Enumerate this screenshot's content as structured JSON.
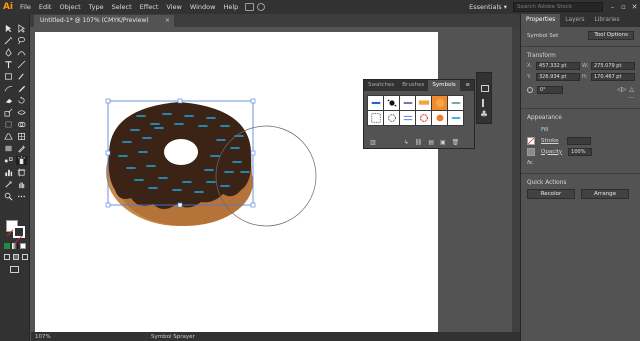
{
  "app": {
    "logo": "Ai"
  },
  "menu": {
    "items": [
      "File",
      "Edit",
      "Object",
      "Type",
      "Select",
      "Effect",
      "View",
      "Window",
      "Help"
    ]
  },
  "workspace": {
    "label": "Essentials ▾",
    "search_placeholder": "Search Adobe Stock"
  },
  "window_buttons": [
    "–",
    "▫",
    "✕"
  ],
  "document": {
    "tab_title": "Untitled-1* @ 107% (CMYK/Preview)",
    "close": "×"
  },
  "status": {
    "zoom": "107%",
    "tool": "Symbol Sprayer"
  },
  "properties": {
    "tabs": [
      "Properties",
      "Layers",
      "Libraries"
    ],
    "selection_type": "Symbol Set",
    "tool_options": "Tool Options",
    "transform_title": "Transform",
    "x_label": "X:",
    "x_value": "457.332 pt",
    "y_label": "Y:",
    "y_value": "326.934 pt",
    "w_label": "W:",
    "w_value": "275.079 pt",
    "h_label": "H:",
    "h_value": "170.467 pt",
    "rotate_value": "0°",
    "appearance_title": "Appearance",
    "fill_label": "Fill",
    "stroke_label": "Stroke",
    "opacity_label": "Opacity",
    "opacity_value": "100%",
    "fx_label": "fx.",
    "quick_actions_title": "Quick Actions",
    "recolor": "Recolor",
    "arrange": "Arrange"
  },
  "symbols_panel": {
    "tabs": [
      "Swatches",
      "Brushes",
      "Symbols"
    ],
    "menu_icon": "≡"
  },
  "colors": {
    "accent": "#ff9a00",
    "selection": "#4a7cdc",
    "chocolate": "#3b2416",
    "dough": "#c88a4a",
    "sprinkle": "#1ea6e6"
  }
}
